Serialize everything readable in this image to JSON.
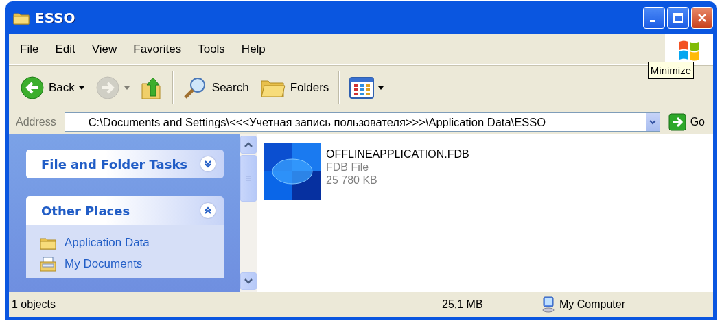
{
  "window": {
    "title": "ESSO",
    "controls": [
      {
        "kind": "minimize"
      },
      {
        "kind": "maximize"
      },
      {
        "kind": "close"
      }
    ]
  },
  "tooltip": {
    "text": "Minimize"
  },
  "menu": [
    {
      "label": "File"
    },
    {
      "label": "Edit"
    },
    {
      "label": "View"
    },
    {
      "label": "Favorites"
    },
    {
      "label": "Tools"
    },
    {
      "label": "Help"
    }
  ],
  "toolbar": [
    {
      "kind": "back",
      "label": "Back",
      "disabled": false,
      "dropdown": true
    },
    {
      "kind": "forward",
      "disabled": true,
      "dropdown": true
    },
    {
      "kind": "up",
      "disabled": false,
      "dropdown": false
    },
    {
      "kind": "separator"
    },
    {
      "kind": "search",
      "label": "Search",
      "disabled": false,
      "dropdown": false
    },
    {
      "kind": "folders",
      "label": "Folders",
      "disabled": false,
      "dropdown": false
    },
    {
      "kind": "separator"
    },
    {
      "kind": "views",
      "disabled": false,
      "dropdown": true
    }
  ],
  "address": {
    "label": "Address",
    "value": "C:\\Documents and Settings\\<<<Учетная запись пользователя>>>\\Application Data\\ESSO",
    "go": "Go"
  },
  "task_pane": {
    "groups": [
      {
        "title": "File and Folder Tasks",
        "expanded": false
      },
      {
        "title": "Other Places",
        "expanded": true,
        "items": [
          {
            "kind": "folder",
            "label": "Application Data"
          },
          {
            "kind": "documents",
            "label": "My Documents"
          }
        ]
      }
    ]
  },
  "files": [
    {
      "name": "OFFLINEAPPLICATION.FDB",
      "type": "FDB File",
      "size": "25 780 KB"
    }
  ],
  "status_bar": {
    "objects": "1 objects",
    "size": "25,1 MB",
    "zone": "My Computer"
  }
}
